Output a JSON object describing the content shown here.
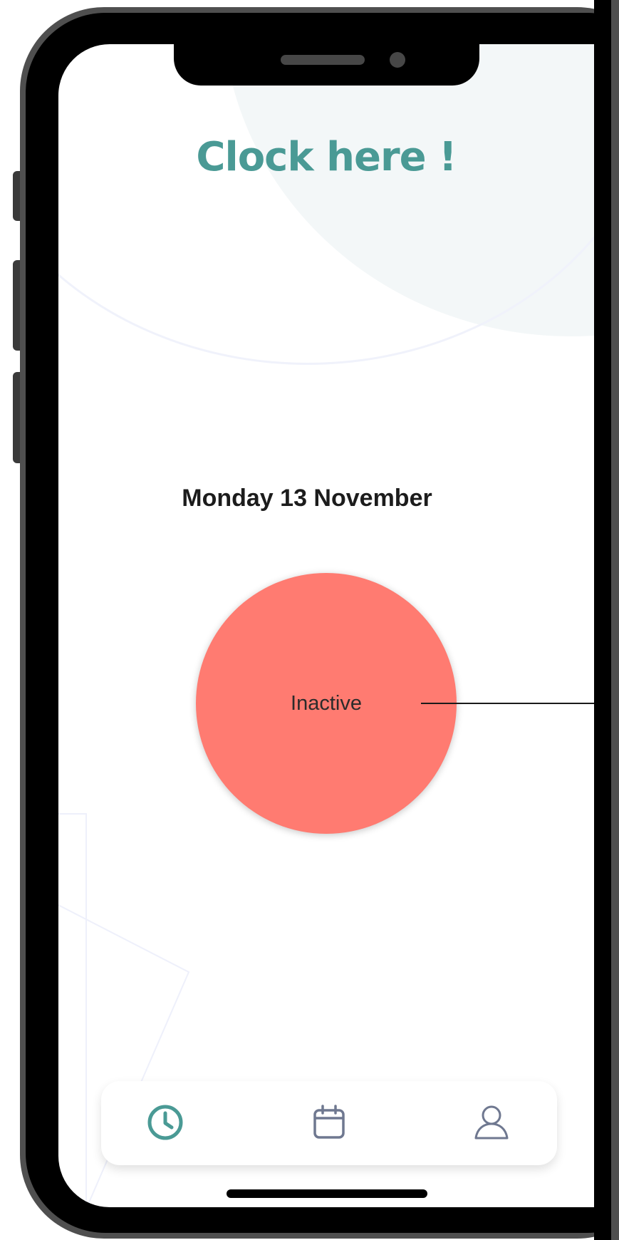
{
  "app": {
    "title": "Clock here !",
    "date": "Monday 13 November"
  },
  "clock_button": {
    "status": "Inactive",
    "color": "#ff7b71"
  },
  "tab_bar": {
    "items": [
      {
        "icon": "clock-icon",
        "active": true,
        "color": "#4a9a95"
      },
      {
        "icon": "calendar-icon",
        "active": false,
        "color": "#6f7890"
      },
      {
        "icon": "user-icon",
        "active": false,
        "color": "#6f7890"
      }
    ]
  },
  "colors": {
    "accent": "#4a9a95",
    "inactive_status": "#ff7b71",
    "background_shape": "#f3f7f8"
  }
}
